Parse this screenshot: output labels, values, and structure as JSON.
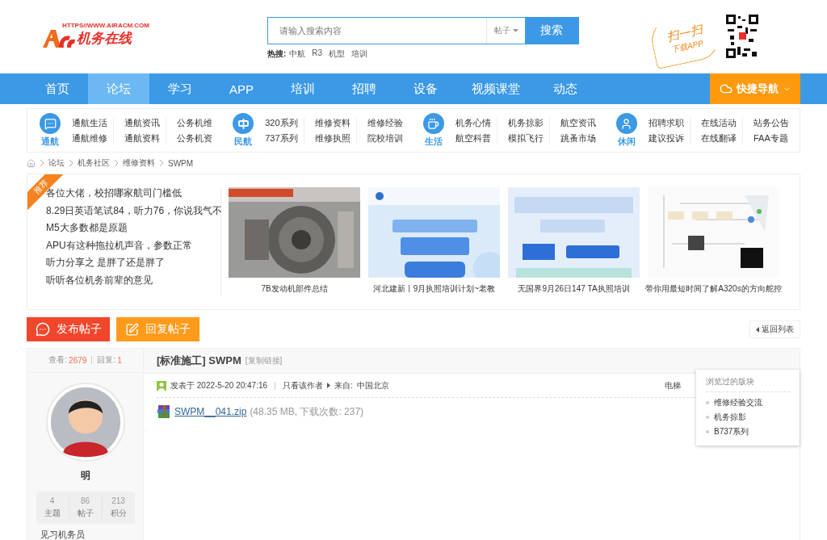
{
  "header": {
    "logo_url": "HTTPS//WWW.AIRACM.COM",
    "logo_name": "机务在线",
    "search": {
      "placeholder": "请输入搜索内容",
      "scope": "帖子",
      "button": "搜索"
    },
    "hot_label": "热搜:",
    "hot": [
      "中航",
      "R3",
      "机型",
      "培训"
    ],
    "app_promo": [
      "扫一扫",
      "下载APP"
    ]
  },
  "nav": {
    "items": [
      {
        "label": "首页",
        "selected": false
      },
      {
        "label": "论坛",
        "selected": true
      },
      {
        "label": "学习",
        "selected": false
      },
      {
        "label": "APP",
        "selected": false
      },
      {
        "label": "培训",
        "selected": false
      },
      {
        "label": "招聘",
        "selected": false
      },
      {
        "label": "设备",
        "selected": false
      },
      {
        "label": "视频课堂",
        "selected": false
      },
      {
        "label": "动态",
        "selected": false
      }
    ],
    "quick": "快捷导航"
  },
  "categories": [
    {
      "label": "通航",
      "columns": [
        [
          "通航生活",
          "通航维修"
        ],
        [
          "通航资讯",
          "通航资料"
        ],
        [
          "公务机维",
          "公务机资"
        ]
      ]
    },
    {
      "label": "民航",
      "columns": [
        [
          "320系列",
          "737系列"
        ],
        [
          "维修资料",
          "维修执照"
        ],
        [
          "维修经验",
          "院校培训"
        ]
      ]
    },
    {
      "label": "生活",
      "columns": [
        [
          "机务心情",
          "航空科普"
        ],
        [
          "机务掠影",
          "模拟飞行"
        ],
        [
          "航空资讯",
          "跳蚤市场"
        ]
      ]
    },
    {
      "label": "休闲",
      "columns": [
        [
          "招聘求职",
          "建议投诉"
        ],
        [
          "在线活动",
          "在线翻译"
        ],
        [
          "站务公告",
          "FAA专题"
        ]
      ]
    }
  ],
  "breadcrumb": [
    "论坛",
    "机务社区",
    "维修资料",
    "SWPM"
  ],
  "featured": {
    "tag": "推荐",
    "headlines": [
      "各位大佬，校招哪家航司门槛低",
      "8.29日英语笔试84，听力76，你说我气不",
      "M5大多数都是原题",
      "APU有这种拖拉机声音，参数正常",
      "听力分享之 是胖了还是胖了",
      "听听各位机务前辈的意见"
    ],
    "cards": [
      {
        "caption": "7B发动机部件总结",
        "kind": "picture"
      },
      {
        "caption": "河北建新丨9月执照培训计划~老教",
        "kind": "picture"
      },
      {
        "caption": "无国界9月26日147 TA执照培训",
        "kind": "picture"
      },
      {
        "caption": "带你用最短时间了解A320s的方向舵控",
        "kind": "picture"
      }
    ]
  },
  "actions": [
    {
      "label": "发布帖子",
      "kind": "new"
    },
    {
      "label": "回复帖子",
      "kind": "reply"
    }
  ],
  "back": "返回列表",
  "post": {
    "views_label": "查看:",
    "views": "2679",
    "replies_label": "回复:",
    "replies": "1",
    "tag": "[标准施工]",
    "title": "SWPM",
    "copy_link": "[复制链接]",
    "posted": "发表于 2022-5-20 20:47:16",
    "author_only": "只看该作者",
    "from_label": "来自:",
    "from": "中国北京",
    "elevator": "电梯",
    "attachment": {
      "name": "SWPM__041.zip",
      "info": "(48.35 MB, 下载次数: 237)"
    }
  },
  "user": {
    "name": "明",
    "stats": [
      {
        "value": "4",
        "label": "主题"
      },
      {
        "value": "86",
        "label": "帖子"
      },
      {
        "value": "213",
        "label": "积分"
      }
    ],
    "rank": "见习机务员"
  },
  "visited": {
    "title": "浏览过的版块",
    "items": [
      "维修经验交流",
      "机务掠影",
      "B737系列"
    ]
  }
}
